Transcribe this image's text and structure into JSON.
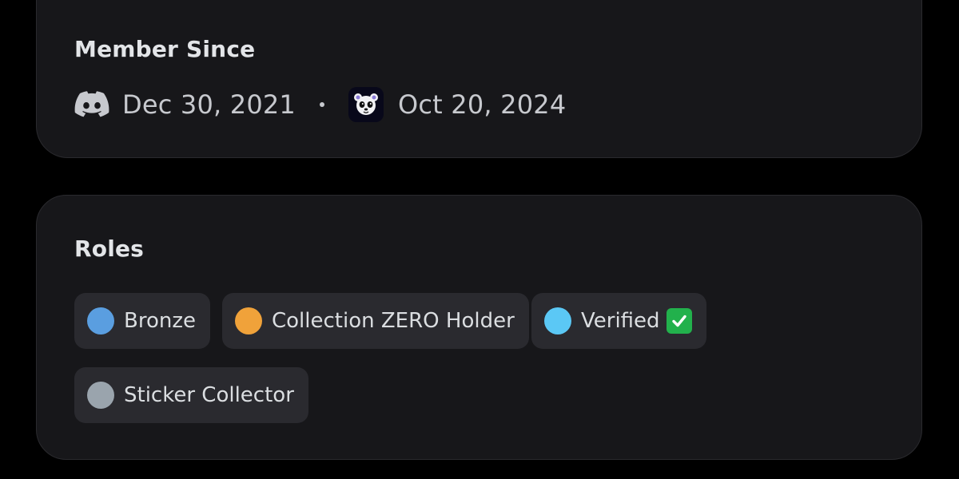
{
  "member_since": {
    "heading": "Member Since",
    "discord_date": "Dec 30, 2021",
    "server_date": "Oct 20, 2024",
    "discord_icon": "discord-logo-icon",
    "server_icon": "server-panda-icon"
  },
  "roles": {
    "heading": "Roles",
    "items": [
      {
        "label": "Bronze",
        "color": "#5a9ee0"
      },
      {
        "label": "Collection ZERO Holder",
        "color": "#f0a23a"
      },
      {
        "label": "Verified",
        "color": "#5bc8f5",
        "badge_icon": "check-mark-button-icon"
      },
      {
        "label": "Sticker Collector",
        "color": "#9aa4ad"
      }
    ]
  },
  "colors": {
    "background": "#000000",
    "card": "#17171a",
    "chip": "#2a2a2f",
    "text": "#dbdee1"
  }
}
